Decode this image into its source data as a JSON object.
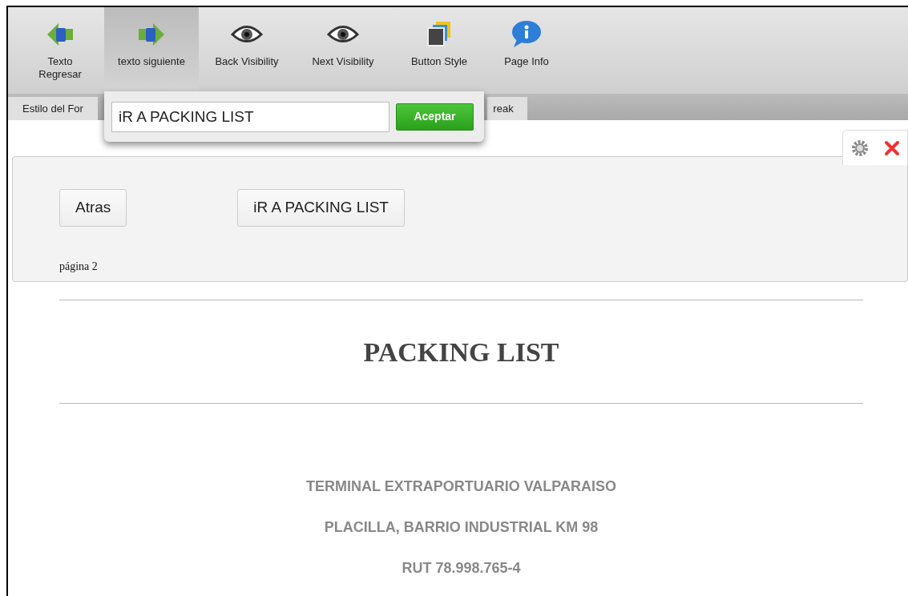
{
  "toolbar": [
    {
      "kind": "arrow-left",
      "label": "Texto Regresar",
      "selected": false
    },
    {
      "kind": "arrow-right",
      "label": "texto siguiente",
      "selected": true
    },
    {
      "kind": "eye",
      "label": "Back Visibility",
      "selected": false
    },
    {
      "kind": "eye",
      "label": "Next Visibility",
      "selected": false
    },
    {
      "kind": "style",
      "label": "Button Style",
      "selected": false
    },
    {
      "kind": "info",
      "label": "Page Info",
      "selected": false
    }
  ],
  "tab_strip": [
    {
      "label": "Estilo del For"
    },
    {
      "label": "reak"
    }
  ],
  "popup": {
    "value": "iR A PACKING LIST",
    "button": "Aceptar"
  },
  "page_panel": {
    "buttons": [
      "Atras",
      "iR A PACKING LIST"
    ],
    "page_label": "página 2"
  },
  "document": {
    "title": "PACKING LIST",
    "lines": [
      "TERMINAL EXTRAPORTUARIO VALPARAISO",
      "PLACILLA, BARRIO INDUSTRIAL KM 98",
      "RUT 78.998.765-4"
    ]
  }
}
